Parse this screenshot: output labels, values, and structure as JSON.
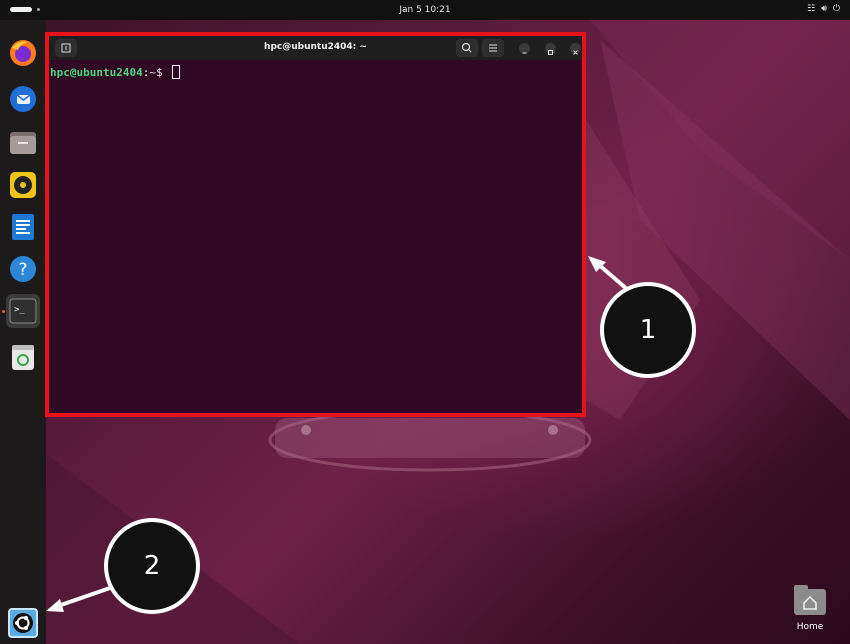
{
  "topbar": {
    "clock": "Jan 5  10:21"
  },
  "dock": {
    "items": [
      {
        "name": "firefox"
      },
      {
        "name": "thunderbird"
      },
      {
        "name": "files"
      },
      {
        "name": "rhythmbox"
      },
      {
        "name": "libreoffice-writer"
      },
      {
        "name": "help"
      },
      {
        "name": "terminal",
        "active": true
      },
      {
        "name": "trash"
      }
    ]
  },
  "terminal": {
    "title": "hpc@ubuntu2404: ~",
    "prompt_user": "hpc@ubuntu2404",
    "prompt_path": ":~$ "
  },
  "callouts": {
    "one": "1",
    "two": "2"
  },
  "desktop": {
    "home_label": "Home"
  },
  "colors": {
    "highlight": "#e8121a",
    "terminal_bg": "#300a24",
    "prompt_green": "#4fd47a",
    "accent": "#e95420"
  }
}
